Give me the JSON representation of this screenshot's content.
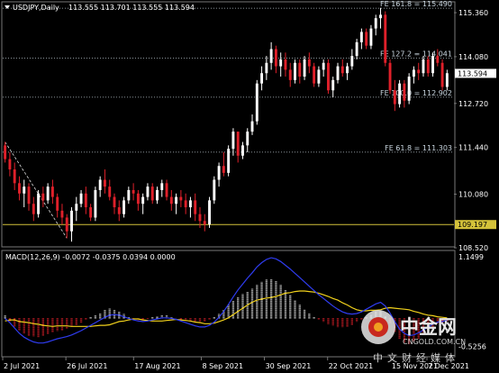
{
  "chart_data": [
    {
      "type": "candlestick",
      "title": "USDJPY,Daily",
      "ohlc_header": "113.555 113.701 113.555 113.594",
      "yticks": [
        "115.360",
        "114.080",
        "112.720",
        "111.440",
        "110.080",
        "108.520"
      ],
      "ytick_values": [
        115.36,
        114.08,
        112.72,
        111.44,
        110.08,
        108.52
      ],
      "ylim": [
        108.6,
        115.65
      ],
      "current_price": "113.594",
      "horizontal_level": {
        "label": "109.197",
        "value": 109.197,
        "color": "#d4c23a"
      },
      "fibonacci": [
        {
          "label": "FE 161.8 = 115.490",
          "value": 115.49
        },
        {
          "label": "FE 127.2 = 114.041",
          "value": 114.041
        },
        {
          "label": "FE 100.0 = 112.902",
          "value": 112.902
        },
        {
          "label": "FE 61.8 = 111.303",
          "value": 111.303
        }
      ],
      "candles": [
        [
          111.5,
          111.6,
          111.0,
          111.1
        ],
        [
          111.1,
          111.3,
          110.6,
          110.8
        ],
        [
          110.8,
          111.0,
          110.2,
          110.4
        ],
        [
          110.4,
          110.6,
          109.9,
          110.1
        ],
        [
          110.1,
          110.5,
          109.7,
          110.3
        ],
        [
          110.3,
          110.4,
          109.6,
          109.8
        ],
        [
          109.8,
          110.0,
          109.3,
          109.5
        ],
        [
          109.5,
          110.2,
          109.4,
          110.1
        ],
        [
          110.1,
          110.3,
          109.7,
          109.9
        ],
        [
          109.9,
          110.4,
          109.8,
          110.3
        ],
        [
          110.3,
          110.5,
          109.8,
          110.0
        ],
        [
          110.0,
          110.1,
          109.4,
          109.6
        ],
        [
          109.6,
          109.8,
          109.2,
          109.4
        ],
        [
          109.4,
          109.5,
          108.8,
          109.0
        ],
        [
          109.0,
          109.7,
          108.7,
          109.6
        ],
        [
          109.6,
          110.0,
          109.3,
          109.8
        ],
        [
          109.8,
          110.2,
          109.7,
          110.1
        ],
        [
          110.1,
          110.3,
          109.5,
          109.7
        ],
        [
          109.7,
          109.8,
          109.3,
          109.4
        ],
        [
          109.4,
          110.3,
          109.3,
          110.2
        ],
        [
          110.2,
          110.6,
          110.0,
          110.5
        ],
        [
          110.5,
          110.8,
          110.1,
          110.3
        ],
        [
          110.3,
          110.5,
          109.9,
          110.0
        ],
        [
          110.0,
          110.1,
          109.5,
          109.7
        ],
        [
          109.7,
          109.9,
          109.3,
          109.5
        ],
        [
          109.5,
          110.0,
          109.4,
          109.9
        ],
        [
          109.9,
          110.3,
          109.8,
          110.2
        ],
        [
          110.2,
          110.4,
          109.9,
          110.1
        ],
        [
          110.1,
          110.2,
          109.6,
          109.8
        ],
        [
          109.8,
          110.1,
          109.5,
          110.0
        ],
        [
          110.0,
          110.4,
          109.9,
          110.3
        ],
        [
          110.3,
          110.4,
          109.8,
          109.9
        ],
        [
          109.9,
          110.3,
          109.8,
          110.2
        ],
        [
          110.2,
          110.5,
          110.0,
          110.4
        ],
        [
          110.4,
          110.5,
          109.9,
          110.0
        ],
        [
          110.0,
          110.2,
          109.6,
          109.8
        ],
        [
          109.8,
          110.1,
          109.5,
          110.0
        ],
        [
          110.0,
          110.2,
          109.7,
          109.9
        ],
        [
          109.9,
          110.1,
          109.5,
          109.7
        ],
        [
          109.7,
          110.0,
          109.4,
          109.9
        ],
        [
          109.9,
          110.1,
          109.3,
          109.5
        ],
        [
          109.5,
          109.7,
          109.1,
          109.3
        ],
        [
          109.3,
          109.5,
          109.0,
          109.2
        ],
        [
          109.2,
          110.0,
          109.1,
          109.9
        ],
        [
          109.9,
          110.6,
          109.8,
          110.5
        ],
        [
          110.5,
          111.0,
          110.3,
          110.9
        ],
        [
          110.9,
          111.3,
          110.6,
          110.7
        ],
        [
          110.7,
          111.5,
          110.6,
          111.4
        ],
        [
          111.4,
          112.0,
          111.2,
          111.9
        ],
        [
          111.9,
          111.9,
          111.0,
          111.2
        ],
        [
          111.2,
          111.6,
          111.1,
          111.5
        ],
        [
          111.5,
          112.0,
          111.3,
          111.9
        ],
        [
          111.9,
          112.4,
          111.8,
          112.2
        ],
        [
          112.2,
          113.4,
          112.1,
          113.3
        ],
        [
          113.3,
          113.8,
          113.1,
          113.6
        ],
        [
          113.6,
          114.1,
          113.4,
          113.9
        ],
        [
          113.9,
          114.5,
          113.7,
          114.3
        ],
        [
          114.3,
          114.4,
          113.6,
          113.8
        ],
        [
          113.8,
          114.2,
          113.5,
          114.0
        ],
        [
          114.0,
          114.2,
          113.5,
          113.7
        ],
        [
          113.7,
          113.9,
          113.2,
          113.4
        ],
        [
          113.4,
          114.0,
          113.3,
          113.9
        ],
        [
          113.9,
          114.0,
          113.3,
          113.5
        ],
        [
          113.5,
          114.1,
          113.4,
          114.0
        ],
        [
          114.0,
          114.2,
          113.6,
          113.8
        ],
        [
          113.8,
          113.9,
          113.2,
          113.3
        ],
        [
          113.3,
          113.8,
          113.2,
          113.7
        ],
        [
          113.7,
          114.0,
          113.5,
          113.9
        ],
        [
          113.9,
          114.0,
          113.0,
          113.1
        ],
        [
          113.1,
          113.5,
          112.9,
          113.4
        ],
        [
          113.4,
          113.9,
          113.3,
          113.8
        ],
        [
          113.8,
          114.0,
          113.5,
          113.6
        ],
        [
          113.6,
          113.9,
          113.4,
          113.8
        ],
        [
          113.8,
          114.3,
          113.7,
          114.1
        ],
        [
          114.1,
          114.6,
          114.0,
          114.5
        ],
        [
          114.5,
          114.9,
          114.3,
          114.8
        ],
        [
          114.8,
          114.9,
          114.3,
          114.4
        ],
        [
          114.4,
          115.0,
          114.3,
          114.9
        ],
        [
          114.9,
          115.3,
          114.7,
          115.2
        ],
        [
          115.2,
          115.5,
          114.9,
          115.3
        ],
        [
          115.3,
          115.4,
          113.8,
          113.9
        ],
        [
          113.9,
          114.0,
          113.0,
          113.1
        ],
        [
          113.1,
          113.4,
          112.5,
          112.7
        ],
        [
          112.7,
          113.4,
          112.6,
          113.3
        ],
        [
          113.3,
          113.4,
          112.6,
          112.8
        ],
        [
          112.8,
          113.6,
          112.7,
          113.5
        ],
        [
          113.5,
          113.8,
          113.3,
          113.7
        ],
        [
          113.7,
          113.9,
          113.4,
          113.6
        ],
        [
          113.6,
          114.1,
          113.5,
          114.0
        ],
        [
          114.0,
          114.1,
          113.5,
          113.6
        ],
        [
          113.6,
          114.2,
          113.5,
          114.1
        ],
        [
          114.1,
          114.3,
          113.8,
          113.9
        ],
        [
          113.9,
          114.0,
          113.1,
          113.2
        ],
        [
          113.2,
          113.7,
          113.1,
          113.6
        ]
      ],
      "x_tick_labels": [
        "2 Jul 2021",
        "26 Jul 2021",
        "17 Aug 2021",
        "8 Sep 2021",
        "30 Sep 2021",
        "22 Oct 2021",
        "15 Nov 2021",
        "7 Dec 2021"
      ]
    },
    {
      "type": "macd",
      "title": "MACD(12,26,9) -0.0072 -0.0375 0.0394 0.0000",
      "yticks": [
        "1.1499",
        "-0.5256"
      ],
      "ylim": [
        -0.7,
        1.25
      ],
      "histogram": [
        0.05,
        -0.05,
        -0.15,
        -0.22,
        -0.28,
        -0.32,
        -0.34,
        -0.35,
        -0.33,
        -0.3,
        -0.26,
        -0.24,
        -0.22,
        -0.2,
        -0.16,
        -0.12,
        -0.08,
        -0.03,
        0.02,
        0.06,
        0.1,
        0.15,
        0.18,
        0.16,
        0.12,
        0.08,
        0.03,
        -0.02,
        -0.04,
        -0.03,
        -0.01,
        0.02,
        0.04,
        0.06,
        0.05,
        0.03,
        0.0,
        -0.02,
        -0.04,
        -0.06,
        -0.07,
        -0.08,
        -0.06,
        -0.03,
        0.02,
        0.08,
        0.16,
        0.25,
        0.33,
        0.4,
        0.45,
        0.5,
        0.55,
        0.62,
        0.68,
        0.72,
        0.74,
        0.7,
        0.62,
        0.52,
        0.44,
        0.34,
        0.25,
        0.17,
        0.1,
        0.03,
        -0.03,
        -0.07,
        -0.11,
        -0.14,
        -0.17,
        -0.17,
        -0.16,
        -0.12,
        -0.07,
        -0.02,
        0.03,
        0.07,
        0.12,
        0.14,
        0.04,
        -0.1,
        -0.25,
        -0.38,
        -0.45,
        -0.48,
        -0.44,
        -0.38,
        -0.3,
        -0.22,
        -0.16,
        -0.1,
        -0.08,
        -0.05
      ],
      "macd_line": [
        0.0,
        -0.08,
        -0.18,
        -0.28,
        -0.35,
        -0.4,
        -0.44,
        -0.46,
        -0.46,
        -0.44,
        -0.41,
        -0.38,
        -0.36,
        -0.34,
        -0.31,
        -0.27,
        -0.23,
        -0.18,
        -0.13,
        -0.08,
        -0.03,
        0.02,
        0.06,
        0.07,
        0.06,
        0.03,
        0.0,
        -0.03,
        -0.05,
        -0.06,
        -0.05,
        -0.03,
        -0.01,
        0.01,
        0.01,
        0.0,
        -0.02,
        -0.05,
        -0.08,
        -0.11,
        -0.14,
        -0.16,
        -0.16,
        -0.13,
        -0.07,
        0.02,
        0.13,
        0.26,
        0.4,
        0.53,
        0.64,
        0.75,
        0.85,
        0.96,
        1.04,
        1.1,
        1.13,
        1.11,
        1.06,
        0.99,
        0.92,
        0.84,
        0.76,
        0.68,
        0.6,
        0.52,
        0.44,
        0.37,
        0.3,
        0.23,
        0.17,
        0.12,
        0.09,
        0.08,
        0.09,
        0.12,
        0.17,
        0.22,
        0.27,
        0.3,
        0.23,
        0.1,
        -0.06,
        -0.2,
        -0.28,
        -0.32,
        -0.31,
        -0.27,
        -0.22,
        -0.16,
        -0.11,
        -0.07,
        -0.06,
        -0.04
      ],
      "signal_line": [
        -0.05,
        -0.03,
        -0.03,
        -0.06,
        -0.07,
        -0.08,
        -0.1,
        -0.11,
        -0.13,
        -0.14,
        -0.15,
        -0.14,
        -0.14,
        -0.14,
        -0.15,
        -0.15,
        -0.15,
        -0.15,
        -0.15,
        -0.14,
        -0.13,
        -0.13,
        -0.12,
        -0.09,
        -0.06,
        -0.05,
        -0.03,
        -0.01,
        -0.01,
        -0.03,
        -0.04,
        -0.05,
        -0.05,
        -0.05,
        -0.04,
        -0.03,
        -0.02,
        -0.03,
        -0.04,
        -0.05,
        -0.07,
        -0.08,
        -0.1,
        -0.1,
        -0.09,
        -0.06,
        -0.03,
        0.01,
        0.07,
        0.13,
        0.19,
        0.25,
        0.3,
        0.34,
        0.36,
        0.38,
        0.39,
        0.41,
        0.44,
        0.47,
        0.48,
        0.5,
        0.51,
        0.51,
        0.5,
        0.49,
        0.47,
        0.44,
        0.41,
        0.37,
        0.34,
        0.29,
        0.25,
        0.2,
        0.16,
        0.14,
        0.14,
        0.15,
        0.15,
        0.16,
        0.19,
        0.2,
        0.19,
        0.18,
        0.17,
        0.16,
        0.13,
        0.11,
        0.08,
        0.06,
        0.05,
        0.03,
        0.02,
        0.01
      ]
    }
  ],
  "watermark": {
    "brand_cn": "中金网",
    "url": "CNGOLD.COM.CN",
    "slogan": "中文财经媒体"
  }
}
